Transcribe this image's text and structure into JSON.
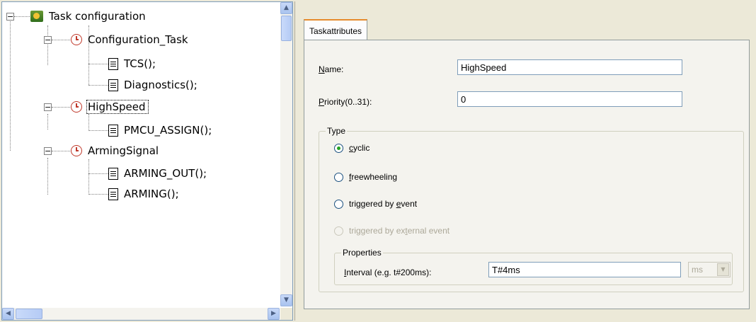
{
  "tree": {
    "root_label": "Task configuration",
    "tasks": [
      {
        "label": "Configuration_Task",
        "children": [
          "TCS();",
          "Diagnostics();"
        ]
      },
      {
        "label": "HighSpeed",
        "children": [
          "PMCU_ASSIGN();"
        ]
      },
      {
        "label": "ArmingSignal",
        "children": [
          "ARMING_OUT();",
          "ARMING();"
        ]
      }
    ],
    "selected": "HighSpeed",
    "icons": {
      "root": "task-config-icon",
      "task": "clock-icon",
      "program": "document-icon"
    }
  },
  "panel": {
    "tab_label": "Taskattributes",
    "name_label_u": "N",
    "name_label_rest": "ame:",
    "name_value": "HighSpeed",
    "priority_label_u": "P",
    "priority_label_rest": "riority(0..31):",
    "priority_value": "0",
    "type_legend": "Type",
    "type_options": [
      {
        "u": "c",
        "rest": "yclic",
        "pre": "",
        "checked": true,
        "enabled": true
      },
      {
        "u": "f",
        "rest": "reewheeling",
        "pre": "",
        "checked": false,
        "enabled": true
      },
      {
        "pre": "triggered by ",
        "u": "e",
        "rest": "vent",
        "checked": false,
        "enabled": true
      },
      {
        "pre": "triggered by ex",
        "u": "t",
        "rest": "ernal event",
        "checked": false,
        "enabled": false
      }
    ],
    "properties_legend": "Properties",
    "interval_label_u": "I",
    "interval_label_rest": "nterval (e.g. t#200ms):",
    "interval_value": "T#4ms",
    "unit_value": "ms"
  },
  "colors": {
    "radio_checked": "#21a121",
    "task_icon": "#c0392b",
    "tab_accent": "#e68b2c"
  }
}
